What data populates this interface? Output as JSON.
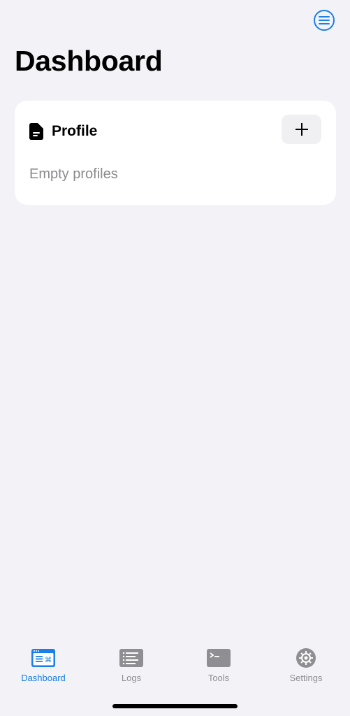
{
  "header": {
    "title": "Dashboard",
    "menu_icon": "hamburger-circle-icon"
  },
  "profile_card": {
    "title": "Profile",
    "icon": "document-icon",
    "add_icon": "plus-icon",
    "empty_text": "Empty profiles"
  },
  "tabbar": {
    "items": [
      {
        "label": "Dashboard",
        "icon": "dashboard-icon",
        "active": true
      },
      {
        "label": "Logs",
        "icon": "logs-icon",
        "active": false
      },
      {
        "label": "Tools",
        "icon": "terminal-icon",
        "active": false
      },
      {
        "label": "Settings",
        "icon": "gear-icon",
        "active": false
      }
    ]
  },
  "colors": {
    "accent": "#1a7fe8",
    "background": "#f2f2f7",
    "inactive": "#8e8e93"
  }
}
